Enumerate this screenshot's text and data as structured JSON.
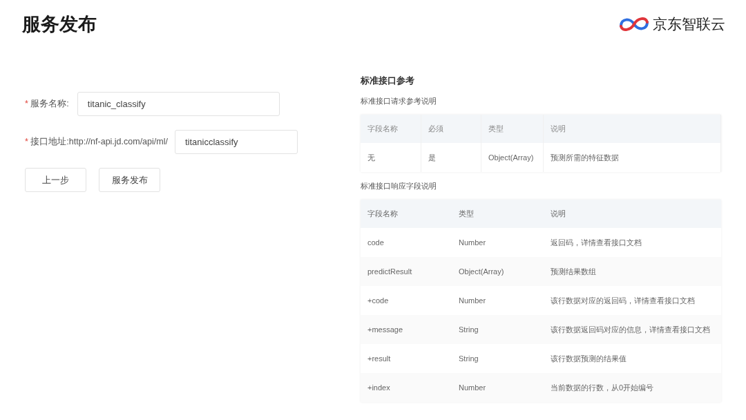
{
  "header": {
    "title": "服务发布",
    "logo_text": "京东智联云"
  },
  "form": {
    "fields": [
      {
        "required_mark": "*",
        "label": "服务名称:",
        "value": "titanic_classify",
        "kind": "short"
      },
      {
        "required_mark": "*",
        "label": "接口地址:http://nf-api.jd.com/api/ml/",
        "value": "titanicclassify",
        "kind": "narrow"
      }
    ],
    "buttons": [
      "上一步",
      "服务发布"
    ]
  },
  "reference": {
    "title": "标准接口参考",
    "request_caption": "标准接口请求参考说明",
    "request_table": {
      "columns": [
        "字段名称",
        "必须",
        "类型",
        "说明"
      ],
      "rows": [
        [
          "无",
          "是",
          "Object(Array)",
          "预测所需的特征数据"
        ]
      ]
    },
    "response_caption": "标准接口响应字段说明",
    "response_table": {
      "columns": [
        "字段名称",
        "类型",
        "说明"
      ],
      "rows": [
        [
          "code",
          "Number",
          "返回码，详情查看接口文档"
        ],
        [
          "predictResult",
          "Object(Array)",
          "预测结果数组"
        ],
        [
          "+code",
          "Number",
          "该行数据对应的返回码，详情查看接口文档"
        ],
        [
          "+message",
          "String",
          "该行数据返回码对应的信息，详情查看接口文档"
        ],
        [
          "+result",
          "String",
          "该行数据预测的结果值"
        ],
        [
          "+index",
          "Number",
          "当前数据的行数，从0开始编号"
        ]
      ]
    }
  }
}
